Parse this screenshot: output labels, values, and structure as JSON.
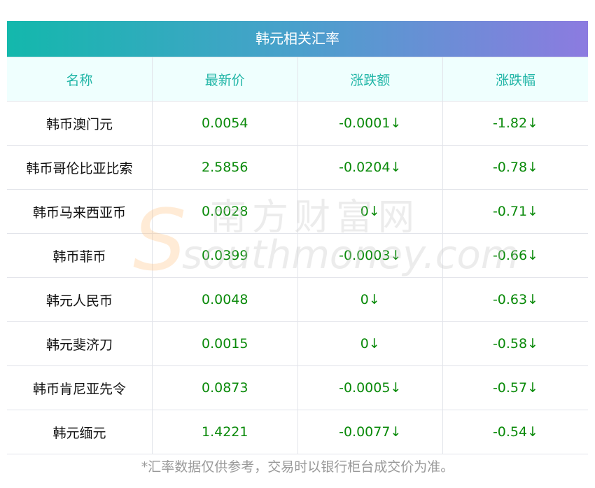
{
  "title": "韩元相关汇率",
  "columns": [
    "名称",
    "最新价",
    "涨跌额",
    "涨跌幅"
  ],
  "rows": [
    [
      "韩币澳门元",
      "0.0054",
      "-0.0001↓",
      "-1.82↓"
    ],
    [
      "韩币哥伦比亚比索",
      "2.5856",
      "-0.0204↓",
      "-0.78↓"
    ],
    [
      "韩币马来西亚币",
      "0.0028",
      "0↓",
      "-0.71↓"
    ],
    [
      "韩币菲币",
      "0.0399",
      "-0.0003↓",
      "-0.66↓"
    ],
    [
      "韩元人民币",
      "0.0048",
      "0↓",
      "-0.63↓"
    ],
    [
      "韩元斐济刀",
      "0.0015",
      "0↓",
      "-0.58↓"
    ],
    [
      "韩币肯尼亚先令",
      "0.0873",
      "-0.0005↓",
      "-0.57↓"
    ],
    [
      "韩元缅元",
      "1.4221",
      "-0.0077↓",
      "-0.54↓"
    ]
  ],
  "footnote": "*汇率数据仅供参考，交易时以银行柜台成交价为准。",
  "watermark": {
    "cn": "南方财富网",
    "en": "southmoney.com"
  }
}
